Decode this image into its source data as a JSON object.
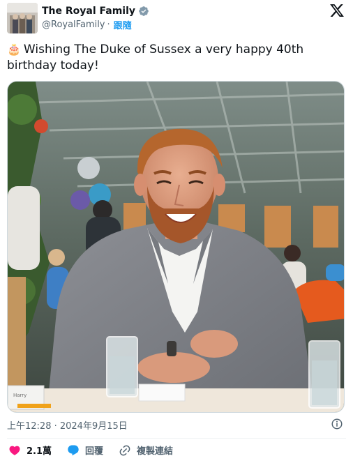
{
  "account": {
    "display_name": "The Royal Family",
    "handle": "@RoyalFamily",
    "separator": "·",
    "follow_label": "跟隨",
    "verified_color": "#829aab"
  },
  "tweet": {
    "emoji": "🎂",
    "text": "Wishing The Duke of Sussex a very happy 40th birthday today!",
    "timestamp": "上午12:28 · 2024年9月15日"
  },
  "media": {
    "table_card_text": "Harry"
  },
  "actions": {
    "like_count": "2.1萬",
    "reply_label": "回覆",
    "copy_link_label": "複製連結",
    "like_color": "#f91880",
    "reply_color": "#1d9bf0"
  }
}
